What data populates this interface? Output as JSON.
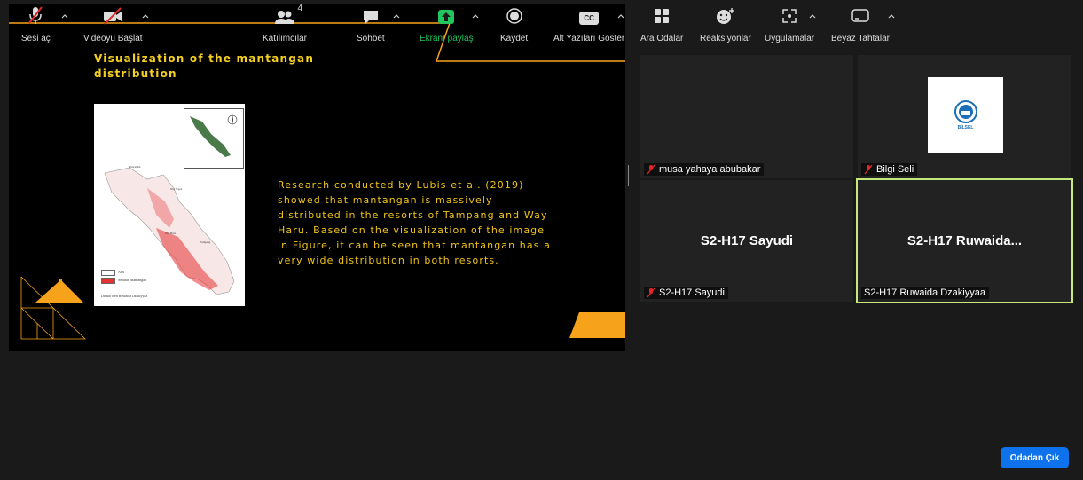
{
  "slide": {
    "title": "Visualization of the mantangan distribution",
    "body": "Research conducted by Lubis et al. (2019) showed that mantangan is massively distributed in the resorts of Tampang and Way Haru. Based on the visualization of the image in Figure, it can be seen that mantangan has a very wide distribution in both resorts.",
    "map_legend": {
      "aoi": "AOI",
      "mantangan": "Sebaran Mantangan",
      "credit": "Dibuat oleh Ruwaida Dzakiyyaa"
    },
    "colors": {
      "accent": "#f7a21b",
      "title": "#f5d020",
      "body": "#f0c419"
    }
  },
  "participants": [
    {
      "name": "musa yahaya abubakar",
      "muted": true
    },
    {
      "name": "Bilgi Seli",
      "muted": true,
      "logo_text": "BİLSEL"
    },
    {
      "name": "S2-H17 Sayudi",
      "display": "S2-H17 Sayudi",
      "muted": true
    },
    {
      "name": "S2-H17 Ruwaida Dzakiyyaa",
      "display": "S2-H17  Ruwaida...",
      "active_speaker": true
    }
  ],
  "toolbar": {
    "unmute": "Sesi aç",
    "start_video": "Videoyu Başlat",
    "participants": "Katılımcılar",
    "participant_count": "4",
    "chat": "Sohbet",
    "share": "Ekranı paylaş",
    "record": "Kaydet",
    "captions": "Alt Yazıları Göster",
    "cc": "CC",
    "breakout": "Ara Odalar",
    "reactions": "Reaksiyonlar",
    "apps": "Uygulamalar",
    "whiteboard": "Beyaz Tahtalar",
    "leave": "Odadan Çık"
  },
  "colors": {
    "leave": "#0e72ed",
    "share": "#22c55e",
    "muted": "#e02828",
    "active_border": "#c7e87a"
  }
}
